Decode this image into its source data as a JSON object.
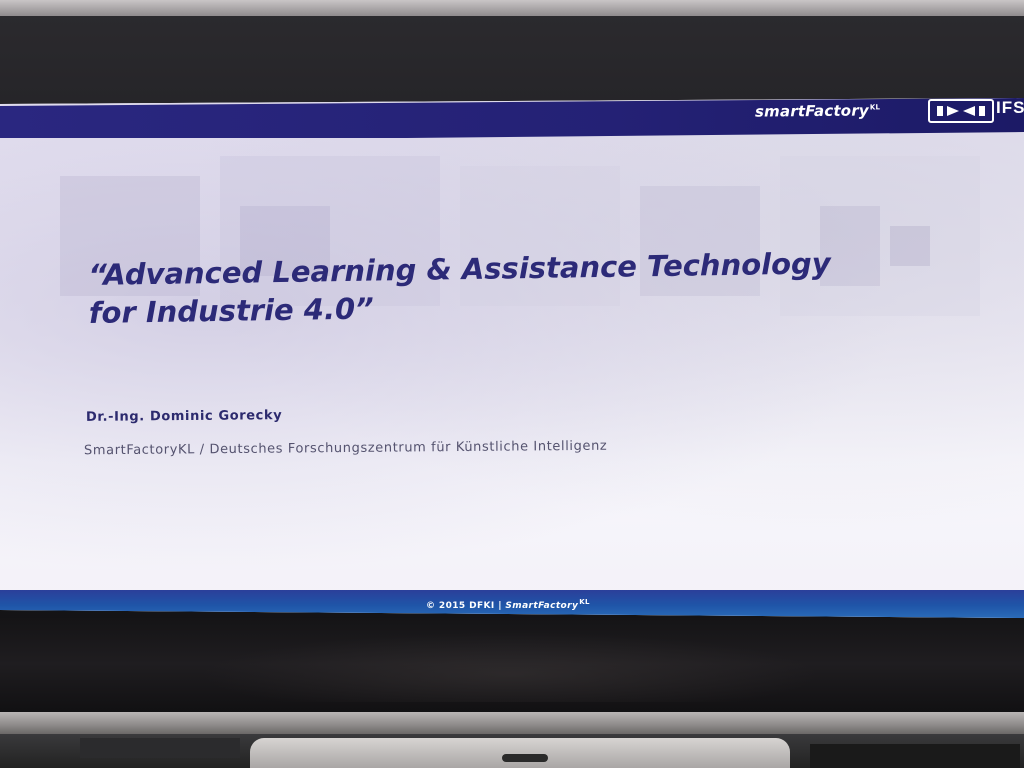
{
  "slide": {
    "header": {
      "brand": "smartFactory",
      "brand_sup": "KL",
      "ifs_text": "IFS"
    },
    "title": {
      "line1": "“Advanced Learning & Assistance Technology",
      "line2": "for Industrie 4.0”"
    },
    "author": "Dr.-Ing. Dominic Gorecky",
    "affiliation": "SmartFactoryKL / Deutsches Forschungszentrum für Künstliche Intelligenz",
    "footer": {
      "copyright": "© 2015 DFKI | ",
      "brand": "SmartFactory",
      "brand_sup": "KL"
    }
  },
  "colors": {
    "header_bar": "#2a2780",
    "title_text": "#2c2a78",
    "footer_bar": "#1f55a8",
    "slide_background": "#f2f0f8"
  }
}
